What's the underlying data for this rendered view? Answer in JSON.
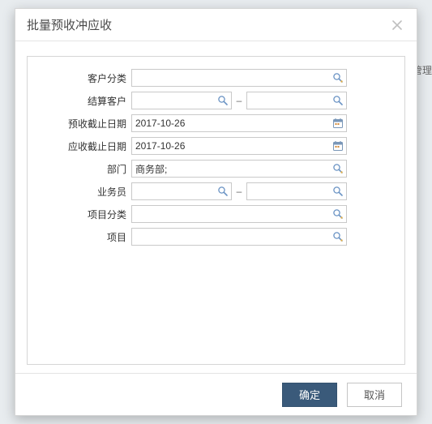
{
  "dialog": {
    "title": "批量预收冲应收",
    "bg_hint": "管理"
  },
  "form": {
    "customer_category": {
      "label": "客户分类",
      "value": ""
    },
    "settle_customer": {
      "label": "结算客户",
      "from": "",
      "to": "",
      "sep": "–"
    },
    "prepay_cutoff": {
      "label": "预收截止日期",
      "value": "2017-10-26"
    },
    "receive_cutoff": {
      "label": "应收截止日期",
      "value": "2017-10-26"
    },
    "department": {
      "label": "部门",
      "value": "商务部;"
    },
    "salesman": {
      "label": "业务员",
      "from": "",
      "to": "",
      "sep": "–"
    },
    "project_category": {
      "label": "项目分类",
      "value": ""
    },
    "project": {
      "label": "项目",
      "value": ""
    }
  },
  "buttons": {
    "ok": "确定",
    "cancel": "取消"
  }
}
